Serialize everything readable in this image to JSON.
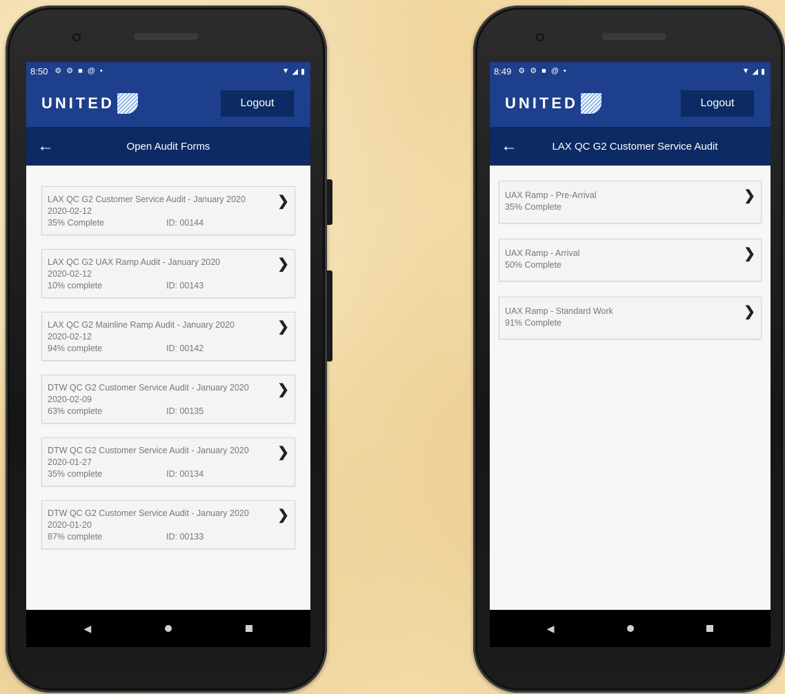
{
  "left_phone": {
    "status": {
      "time": "8:50",
      "icons": [
        "gear-icon",
        "gear-icon",
        "square-icon",
        "at-icon",
        "dot-icon"
      ],
      "right_icons": [
        "wifi-icon",
        "signal-icon",
        "battery-icon"
      ]
    },
    "header": {
      "brand": "UNITED",
      "logout_label": "Logout"
    },
    "subheader": {
      "back_icon": "arrow-left-icon",
      "title": "Open Audit Forms"
    },
    "forms": [
      {
        "title": "LAX QC G2 Customer Service Audit - January 2020",
        "date": "2020-02-12",
        "progress": "35% Complete",
        "id": "ID: 00144"
      },
      {
        "title": "LAX QC G2 UAX Ramp Audit - January 2020",
        "date": "2020-02-12",
        "progress": "10% complete",
        "id": "ID: 00143"
      },
      {
        "title": "LAX QC G2 Mainline Ramp Audit - January 2020",
        "date": "2020-02-12",
        "progress": "94% complete",
        "id": "ID: 00142"
      },
      {
        "title": "DTW QC G2 Customer Service Audit - January 2020",
        "date": "2020-02-09",
        "progress": "63% complete",
        "id": "ID: 00135"
      },
      {
        "title": "DTW QC G2 Customer Service Audit - January 2020",
        "date": "2020-01-27",
        "progress": "35% complete",
        "id": "ID: 00134"
      },
      {
        "title": "DTW QC G2 Customer Service Audit - January 2020",
        "date": "2020-01-20",
        "progress": "87% complete",
        "id": "ID: 00133"
      }
    ]
  },
  "right_phone": {
    "status": {
      "time": "8:49"
    },
    "header": {
      "brand": "UNITED",
      "logout_label": "Logout"
    },
    "subheader": {
      "back_icon": "arrow-left-icon",
      "title": "LAX QC G2 Customer Service Audit"
    },
    "sections": [
      {
        "title": "UAX Ramp - Pre-Arrival",
        "progress": "35% Complete"
      },
      {
        "title": "UAX Ramp - Arrival",
        "progress": "50% Complete"
      },
      {
        "title": "UAX Ramp - Standard Work",
        "progress": "91% Complete"
      }
    ]
  },
  "colors": {
    "brand_blue": "#1d3f8c",
    "navy": "#0c2a63",
    "background": "#f3dca8"
  }
}
